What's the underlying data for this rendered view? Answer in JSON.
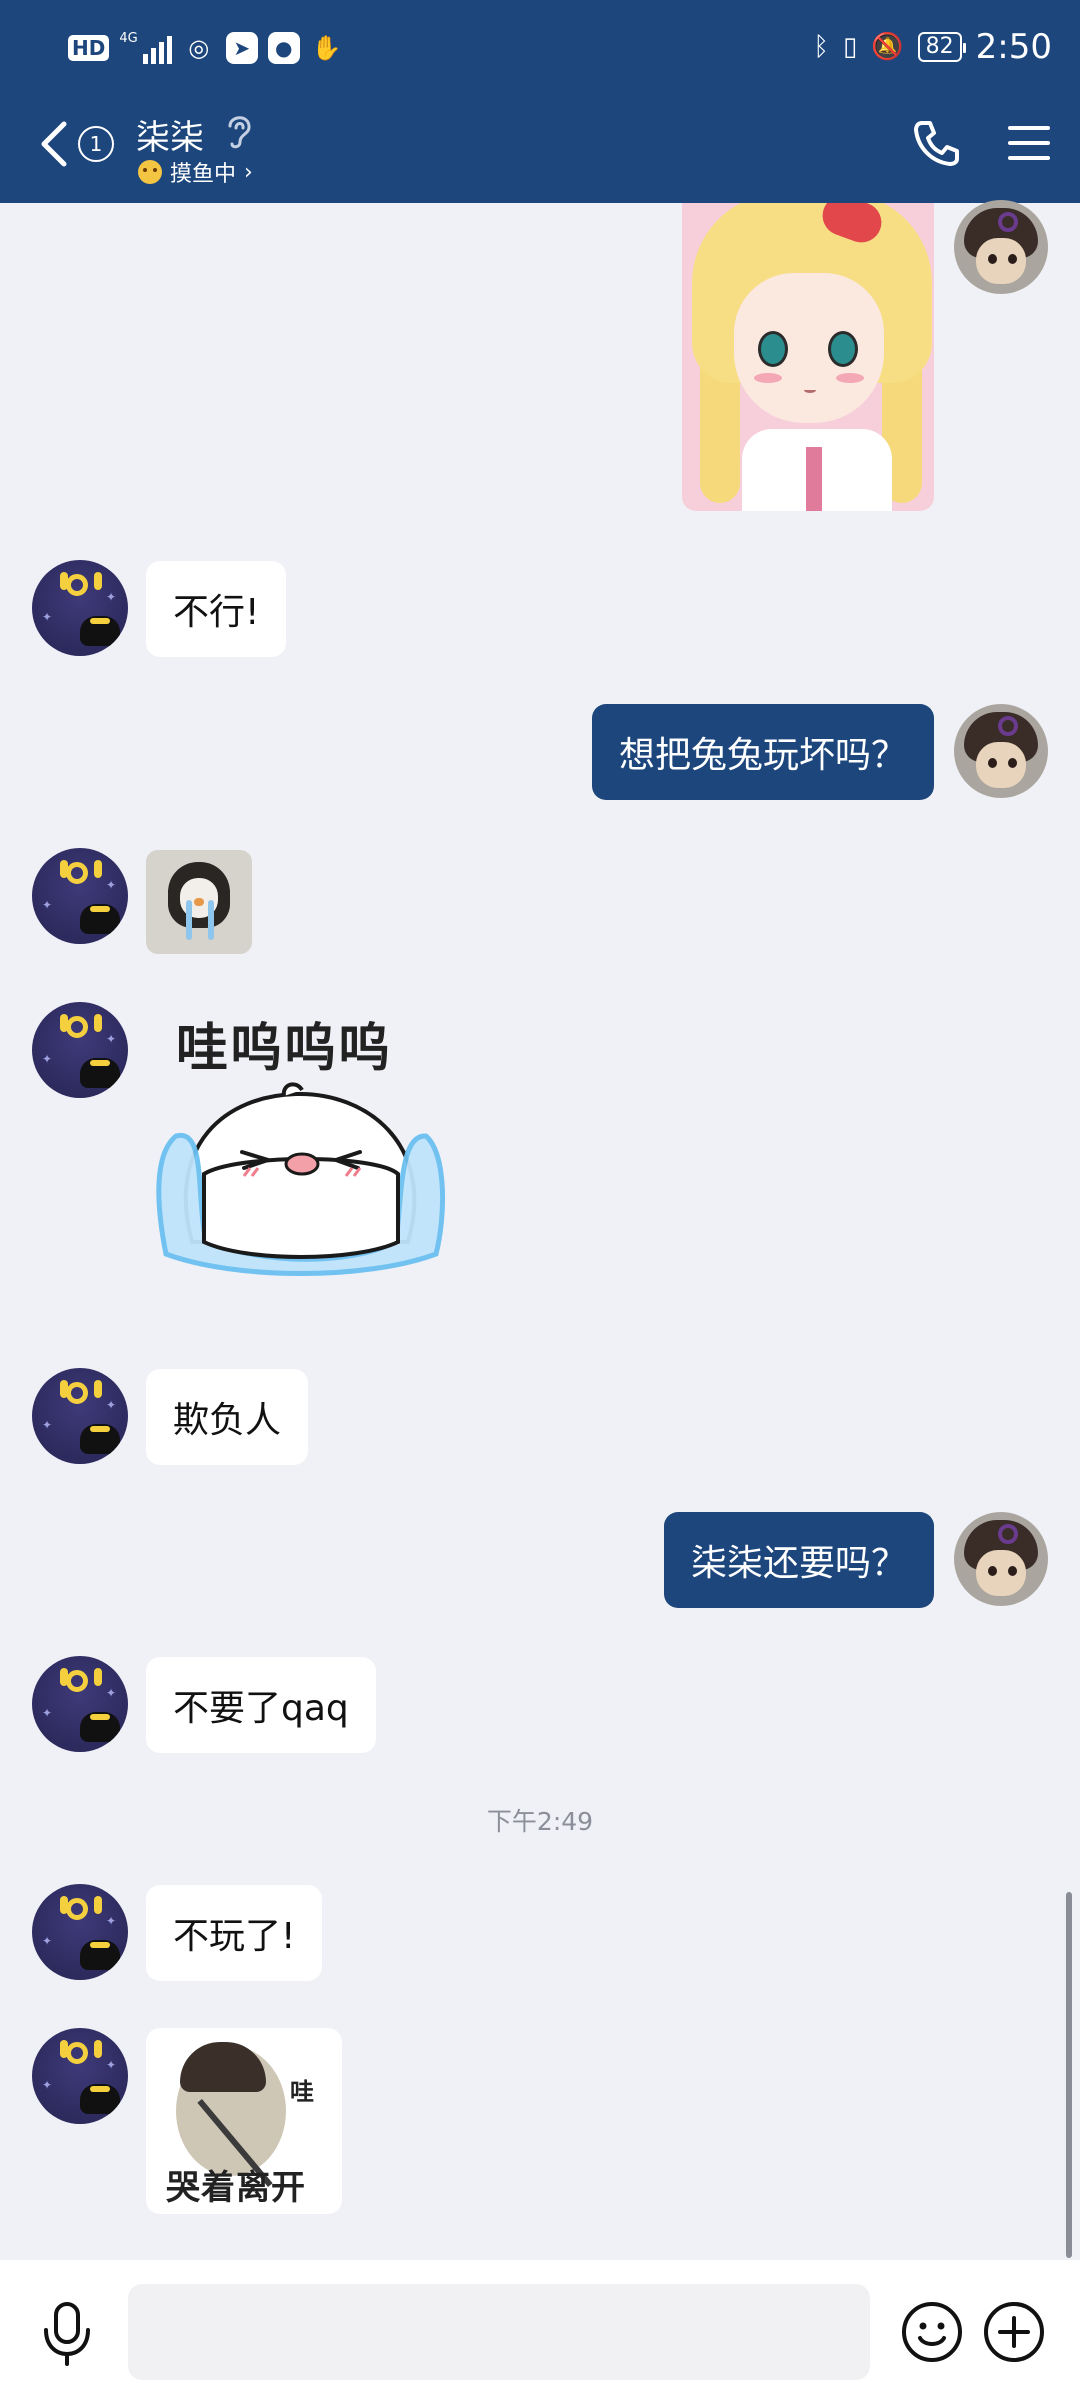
{
  "status_bar": {
    "hd": "HD",
    "network": "4G",
    "battery": "82",
    "time": "2:50"
  },
  "header": {
    "unread_count": "1",
    "contact_name": "柒柒",
    "status_text": "摸鱼中",
    "status_chevron": "›"
  },
  "messages": [
    {
      "side": "in",
      "text": "不行!"
    },
    {
      "side": "out",
      "text": "想把兔兔玩坏吗？"
    },
    {
      "side": "in",
      "text": "欺负人"
    },
    {
      "side": "out",
      "text": "柒柒还要吗？"
    },
    {
      "side": "in",
      "text": "不要了qaq"
    },
    {
      "side": "in",
      "text": "不玩了!"
    }
  ],
  "timestamp": "下午2:49",
  "stickers": {
    "crying_caption": "哇呜呜呜",
    "leaving_wa": "哇",
    "leaving_caption": "哭着离开"
  },
  "colors": {
    "header_bg": "#1c467c",
    "chat_bg": "#f0f1f6",
    "outgoing_bubble": "#1c467c",
    "incoming_bubble": "#ffffff"
  },
  "icons": {
    "back": "chevron-left",
    "ear": "ear",
    "phone": "phone",
    "menu": "hamburger",
    "mic": "microphone",
    "emoji": "smiley",
    "plus": "circle-plus"
  }
}
